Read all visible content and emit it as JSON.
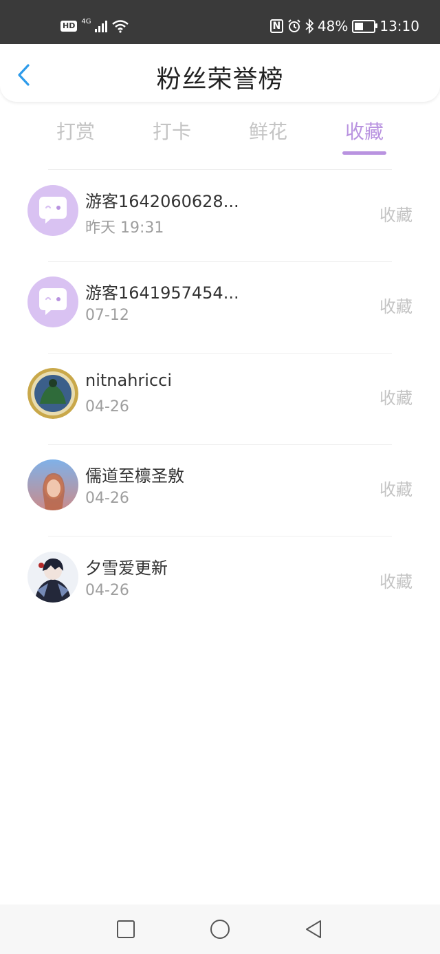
{
  "status_bar": {
    "hd": "HD",
    "network": "4G",
    "battery": "48%",
    "battery_level": 0.48,
    "time": "13:10"
  },
  "header": {
    "title": "粉丝荣誉榜"
  },
  "tabs": [
    {
      "label": "打赏",
      "active": false
    },
    {
      "label": "打卡",
      "active": false
    },
    {
      "label": "鲜花",
      "active": false
    },
    {
      "label": "收藏",
      "active": true
    }
  ],
  "fans": [
    {
      "name": "游客1642060628...",
      "time": "昨天 19:31",
      "action": "收藏",
      "avatar": "guest-avatar-icon"
    },
    {
      "name": "游客1641957454...",
      "time": "07-12",
      "action": "收藏",
      "avatar": "guest-avatar-icon"
    },
    {
      "name": "nitnahricci",
      "time": "04-26",
      "action": "收藏",
      "avatar": "user-avatar"
    },
    {
      "name": "儒道至檩圣敫",
      "time": "04-26",
      "action": "收藏",
      "avatar": "user-avatar"
    },
    {
      "name": "夕雪爱更新",
      "time": "04-26",
      "action": "收藏",
      "avatar": "user-avatar"
    }
  ],
  "colors": {
    "accent": "#b993e0",
    "status_bar": "#3a3a3a",
    "back_arrow": "#2d9bea"
  }
}
